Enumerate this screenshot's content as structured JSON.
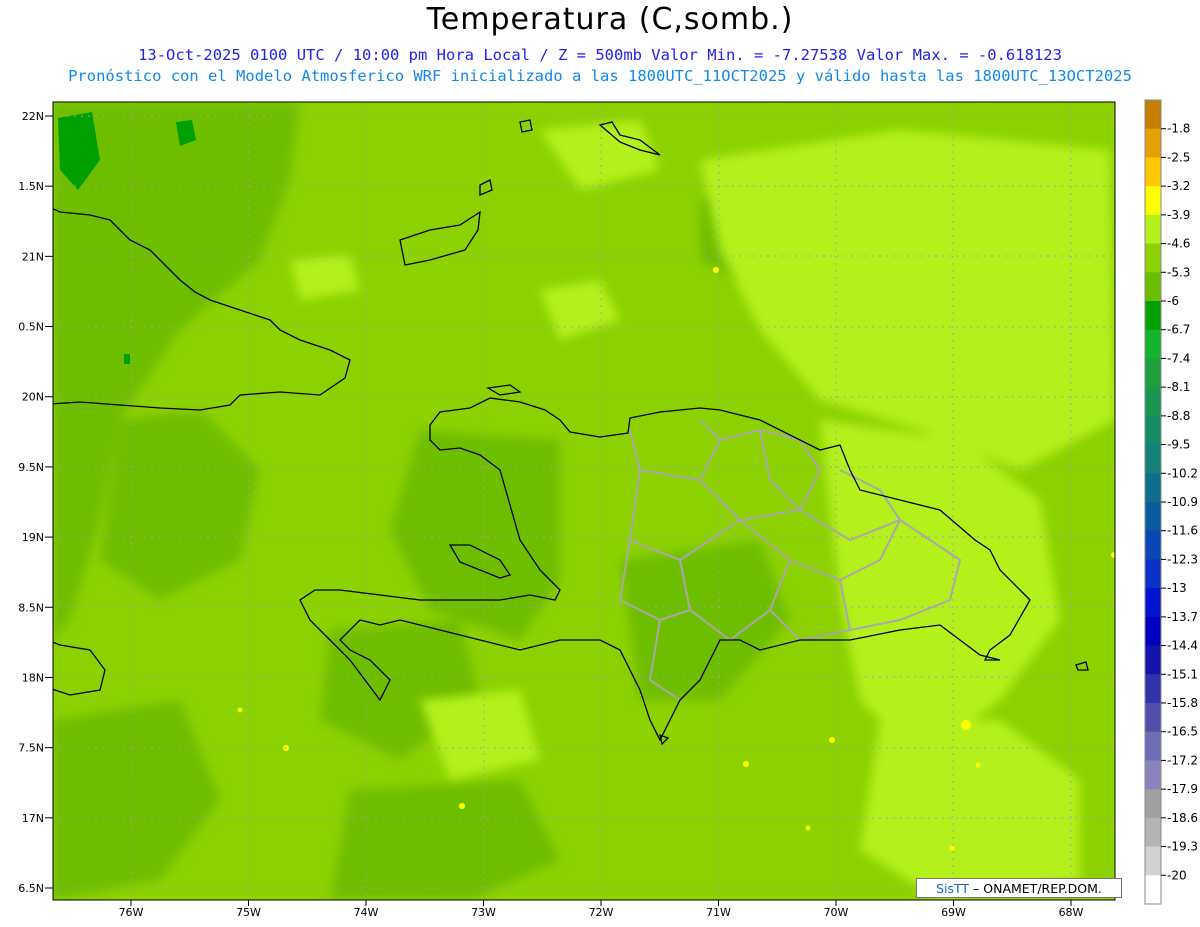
{
  "title": "Temperatura (C,somb.)",
  "subtitle_line1": "13-Oct-2025  0100 UTC / 10:00 pm Hora Local / Z = 500mb Valor Min. = -7.27538  Valor Max. = -0.618123",
  "subtitle_line2": "Pronóstico con el Modelo Atmosferico WRF inicializado a las 1800UTC_11OCT2025 y válido hasta las  1800UTC_13OCT2025",
  "credit": {
    "brand": "SisTT",
    "text": " – ONAMET/REP.DOM."
  },
  "lat_labels": [
    "22N",
    "1.5N",
    "21N",
    "0.5N",
    "20N",
    "9.5N",
    "19N",
    "8.5N",
    "18N",
    "7.5N",
    "17N",
    "6.5N"
  ],
  "lon_labels": [
    "76W",
    "75W",
    "74W",
    "73W",
    "72W",
    "71W",
    "70W",
    "69W",
    "68W"
  ],
  "colorbar": {
    "labels": [
      "-1.8",
      "-2.5",
      "-3.2",
      "-3.9",
      "-4.6",
      "-5.3",
      "-6",
      "-6.7",
      "-7.4",
      "-8.1",
      "-8.8",
      "-9.5",
      "-10.2",
      "-10.9",
      "-11.6",
      "-12.3",
      "-13",
      "-13.7",
      "-14.4",
      "-15.1",
      "-15.8",
      "-16.5",
      "-17.2",
      "-17.9",
      "-18.6",
      "-19.3",
      "-20"
    ],
    "colors": [
      "#c87f00",
      "#e6a000",
      "#ffc800",
      "#ffff00",
      "#b4f01e",
      "#8cd200",
      "#6ebe00",
      "#00a000",
      "#14b42d",
      "#1ea03c",
      "#199650",
      "#168c64",
      "#148278",
      "#0f6e8c",
      "#0a5aa0",
      "#0a46b4",
      "#0a32c8",
      "#0014d2",
      "#0000be",
      "#1414aa",
      "#3232aa",
      "#5050aa",
      "#6e6eb4",
      "#8c82be",
      "#a0a0a0",
      "#b4b4b4",
      "#d2d2d2",
      "#ffffff"
    ]
  },
  "map_colors": {
    "base": "#8cd200",
    "cool": "#6ebe00",
    "warm": "#b4f01e",
    "cold": "#00a000",
    "hot": "#ffff00"
  }
}
